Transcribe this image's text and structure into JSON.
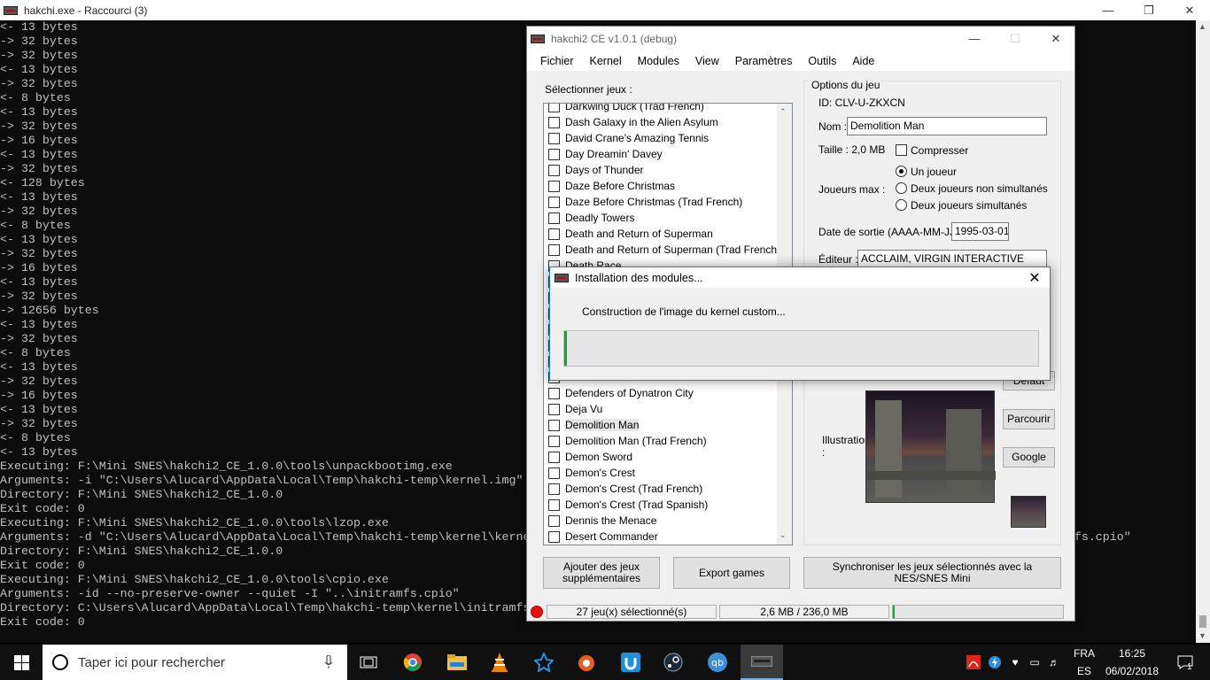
{
  "console": {
    "title": "hakchi.exe - Raccourci (3)",
    "lines": [
      "<- 13 bytes",
      "-> 32 bytes",
      "-> 32 bytes",
      "<- 13 bytes",
      "-> 32 bytes",
      "<- 8 bytes",
      "<- 13 bytes",
      "-> 32 bytes",
      "-> 16 bytes",
      "<- 13 bytes",
      "-> 32 bytes",
      "<- 128 bytes",
      "<- 13 bytes",
      "-> 32 bytes",
      "<- 8 bytes",
      "<- 13 bytes",
      "-> 32 bytes",
      "-> 16 bytes",
      "<- 13 bytes",
      "-> 32 bytes",
      "-> 12656 bytes",
      "<- 13 bytes",
      "-> 32 bytes",
      "<- 8 bytes",
      "<- 13 bytes",
      "-> 32 bytes",
      "-> 16 bytes",
      "<- 13 bytes",
      "-> 32 bytes",
      "<- 8 bytes",
      "<- 13 bytes",
      "Executing: F:\\Mini SNES\\hakchi2_CE_1.0.0\\tools\\unpackbootimg.exe",
      "Arguments: -i \"C:\\Users\\Alucard\\AppData\\Local\\Temp\\hakchi-temp\\kernel.img\"",
      "Directory: F:\\Mini SNES\\hakchi2_CE_1.0.0",
      "Exit code: 0",
      "Executing: F:\\Mini SNES\\hakchi2_CE_1.0.0\\tools\\lzop.exe",
      "Arguments: -d \"C:\\Users\\Alucard\\AppData\\Local\\Temp\\hakchi-temp\\kernel\\kernel.img-ramdisk.gz\" -o \"C:\\Users\\Alucard\\AppData\\Local\\Temp\\hakchi-temp\\initramfs.cpio\"",
      "Directory: F:\\Mini SNES\\hakchi2_CE_1.0.0",
      "Exit code: 0",
      "Executing: F:\\Mini SNES\\hakchi2_CE_1.0.0\\tools\\cpio.exe",
      "Arguments: -id --no-preserve-owner --quiet -I \"..\\initramfs.cpio\"",
      "Directory: C:\\Users\\Alucard\\AppData\\Local\\Temp\\hakchi-temp\\kernel\\initramfs",
      "Exit code: 0"
    ]
  },
  "hakchi": {
    "title": "hakchi2 CE v1.0.1 (debug)",
    "menu": [
      "Fichier",
      "Kernel",
      "Modules",
      "View",
      "Paramètres",
      "Outils",
      "Aide"
    ],
    "select_label": "Sélectionner jeux :",
    "games": [
      "Darkwing Duck (Trad French)",
      "Dash Galaxy in the Alien Asylum",
      "David Crane's Amazing Tennis",
      "Day Dreamin' Davey",
      "Days of Thunder",
      "Daze Before Christmas",
      "Daze Before Christmas (Trad French)",
      "Deadly Towers",
      "Death and Return of Superman",
      "Death and Return of Superman (Trad French)",
      "Death Race",
      "",
      "",
      "",
      "",
      "",
      "",
      "",
      "Defenders of Dynatron City",
      "Deja Vu",
      "Demolition Man",
      "Demolition Man (Trad French)",
      "Demon Sword",
      "Demon's Crest",
      "Demon's Crest (Trad French)",
      "Demon's Crest (Trad Spanish)",
      "Dennis the Menace",
      "Desert Commander"
    ],
    "selected_game": "Demolition Man",
    "options": {
      "group_title": "Options du jeu",
      "id": "ID: CLV-U-ZKXCN",
      "name_label": "Nom :",
      "name_value": "Demolition Man",
      "size": "Taille : 2,0 MB",
      "compress_label": "Compresser",
      "players_label": "Joueurs max :",
      "player_options": [
        "Un joueur",
        "Deux joueurs non simultanés",
        "Deux joueurs simultanés"
      ],
      "release_label": "Date de sortie (AAAA-MM-JJ) :",
      "release_value": "1995-03-01",
      "publisher_label": "Éditeur :",
      "publisher_value": "ACCLAIM, VIRGIN INTERACTIVE",
      "default_btn": "Défaut",
      "illustration_label": "Illustration :",
      "browse_btn": "Parcourir",
      "google_btn": "Google"
    },
    "buttons": {
      "add_games": "Ajouter des jeux supplémentaires",
      "export": "Export games",
      "sync": "Synchroniser les jeux sélectionnés avec la NES/SNES Mini"
    },
    "status": {
      "selected": "27 jeu(x) sélectionné(s)",
      "size": "2,6 MB / 236,0 MB",
      "progress": 0.01
    }
  },
  "dialog": {
    "title": "Installation des modules...",
    "message": "Construction de l'image du kernel custom...",
    "progress": 0.005
  },
  "taskbar": {
    "search_placeholder": "Taper ici pour rechercher",
    "lang": "FRA",
    "lang_sub": "ES",
    "time": "16:25",
    "date": "06/02/2018",
    "notification_count": "1"
  }
}
